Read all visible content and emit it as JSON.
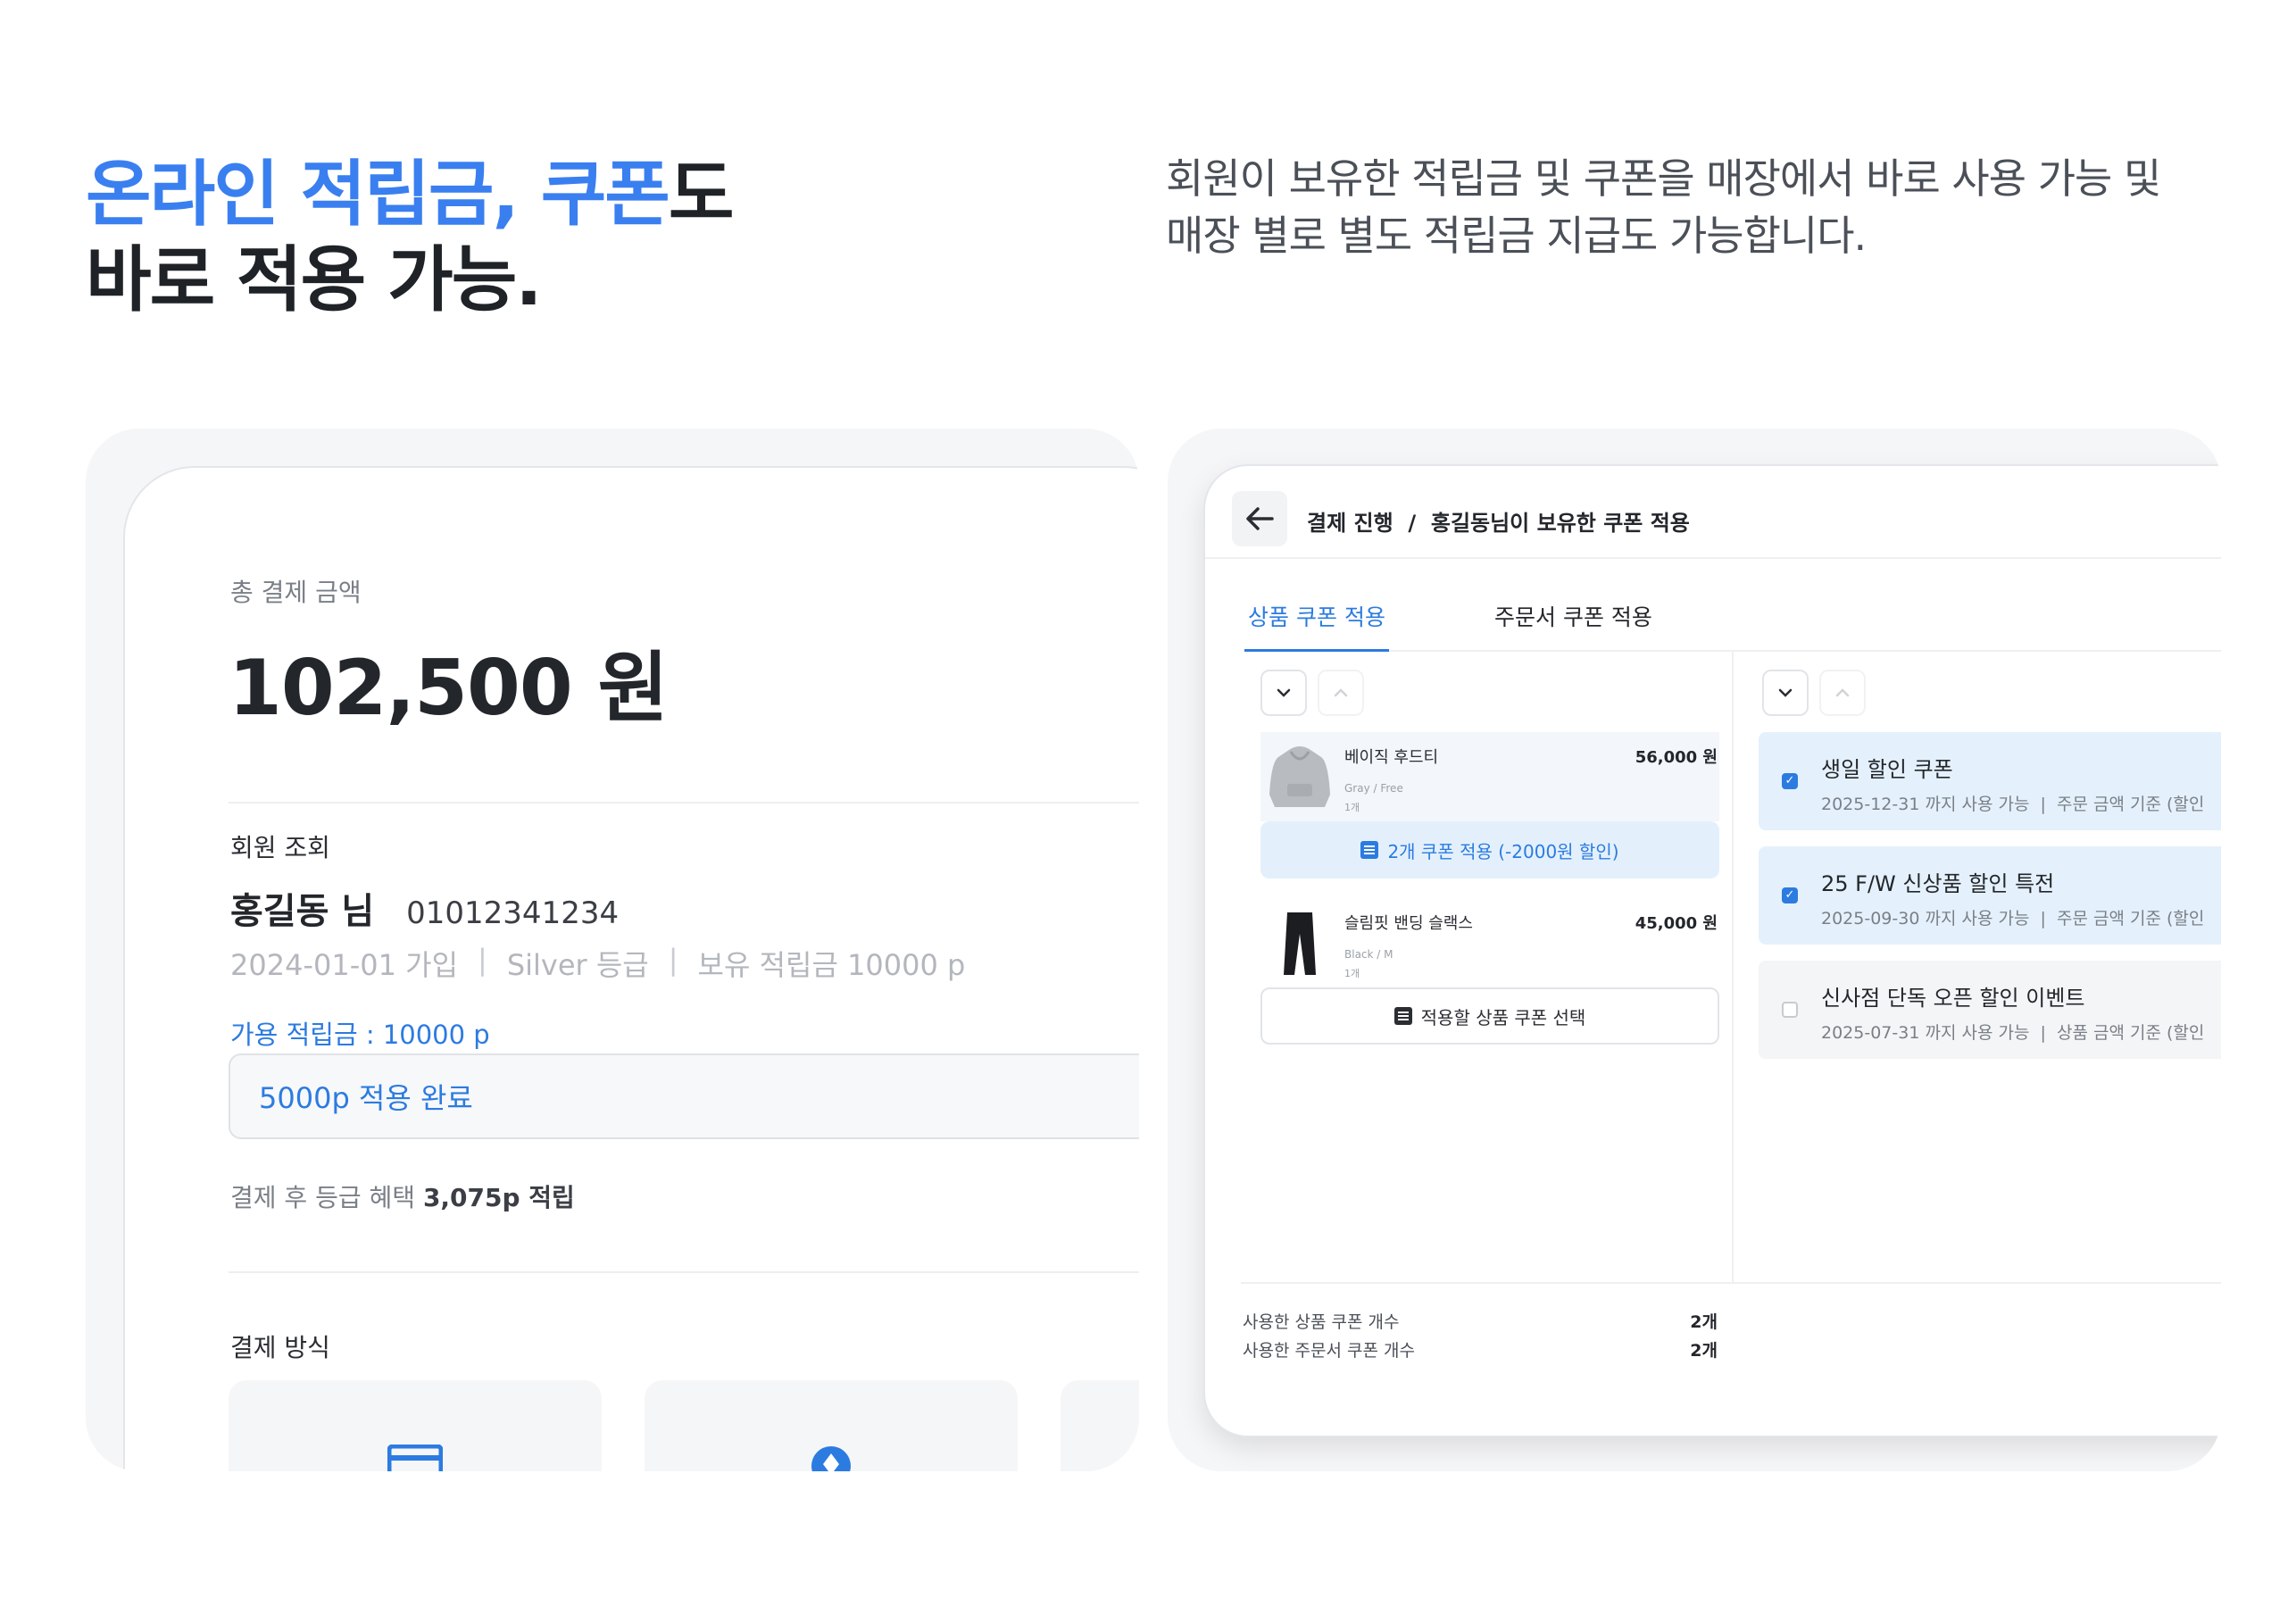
{
  "hero": {
    "title_accent": "온라인 적립금, 쿠폰",
    "title_tail": "도",
    "title_line2": "바로 적용 가능.",
    "desc_line1": "회원이 보유한 적립금 및 쿠폰을 매장에서 바로 사용 가능 및",
    "desc_line2": "매장 별로 별도 적립금 지급도 가능합니다."
  },
  "payment": {
    "total_label": "총 결제 금액",
    "total_amount": "102,500 원",
    "member_section_label": "회원 조회",
    "member_name": "홍길동 님",
    "member_phone": "01012341234",
    "member_joined": "2024-01-01 가입",
    "member_grade": "Silver 등급",
    "member_points": "보유 적립금 10000 p",
    "meta_separator": "|",
    "available_points_label": "가용 적립금 : 10000 p",
    "points_input_value": "5000p 적용 완료",
    "grade_benefit_prefix": "결제 후 등급 혜택",
    "grade_benefit_value": "3,075p 적립",
    "payment_method_label": "결제 방식",
    "payment_method_icons": [
      "card-icon",
      "location-pin-icon"
    ]
  },
  "coupon_screen": {
    "breadcrumb": "결제 진행  /  홍길동님이 보유한 쿠폰 적용",
    "tabs": [
      {
        "label": "상품 쿠폰 적용",
        "active": true
      },
      {
        "label": "주문서 쿠폰 적용",
        "active": false
      }
    ],
    "products": [
      {
        "name": "베이직 후드티",
        "option": "Gray / Free",
        "qty": "1개",
        "price": "56,000 원",
        "coupon_action": "2개 쿠폰 적용 (-2000원 할인)",
        "coupon_applied": true
      },
      {
        "name": "슬림핏 밴딩 슬랙스",
        "option": "Black / M",
        "qty": "1개",
        "price": "45,000 원",
        "coupon_action": "적용할 상품 쿠폰 선택",
        "coupon_applied": false
      }
    ],
    "coupons": [
      {
        "title": "생일 할인 쿠폰",
        "detail": "2025-12-31 까지 사용 가능  |  주문 금액 기준 (할인",
        "checked": true
      },
      {
        "title": "25 F/W 신상품 할인 특전",
        "detail": "2025-09-30 까지 사용 가능  |  주문 금액 기준 (할인",
        "checked": true
      },
      {
        "title": "신사점 단독 오픈 할인 이벤트",
        "detail": "2025-07-31 까지 사용 가능  |  상품 금액 기준 (할인",
        "checked": false
      }
    ],
    "summary": [
      {
        "label": "사용한 상품 쿠폰 개수",
        "value": "2개"
      },
      {
        "label": "사용한 주문서 쿠폰 개수",
        "value": "2개"
      }
    ]
  },
  "colors": {
    "accent": "#3a7ff0",
    "link_blue": "#2c7be0",
    "coupon_bg": "#e4f1fc",
    "panel_bg": "#f5f6f8"
  }
}
